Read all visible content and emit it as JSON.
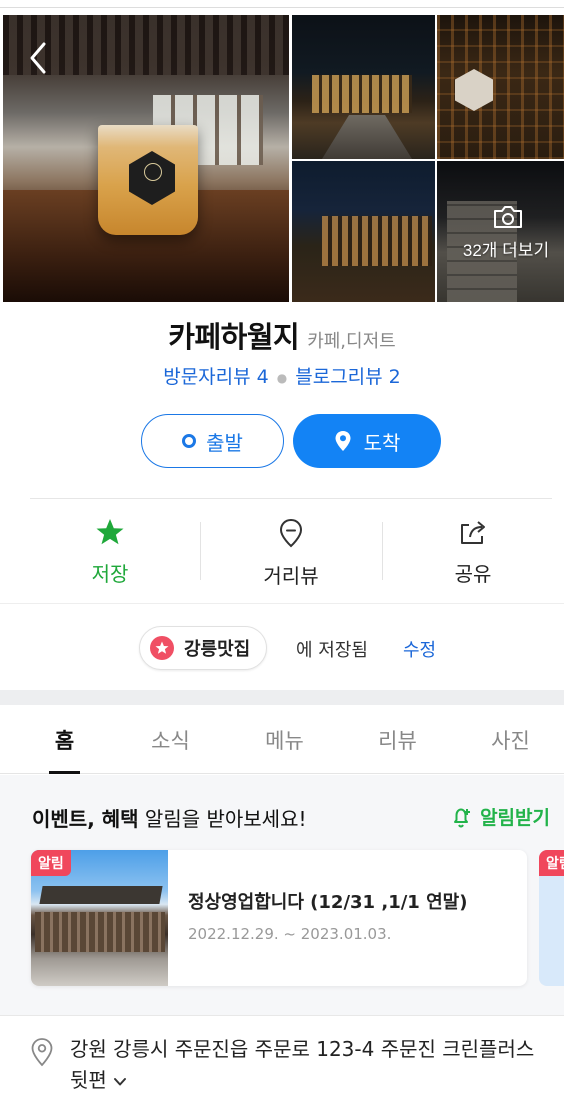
{
  "gallery": {
    "more_photos_label": "32개 더보기"
  },
  "place": {
    "name": "카페하월지",
    "category": "카페,디저트",
    "visitor_review_label": "방문자리뷰 4",
    "blog_review_label": "블로그리뷰 2"
  },
  "route": {
    "start_label": "출발",
    "arrive_label": "도착"
  },
  "actions": {
    "save_label": "저장",
    "street_view_label": "거리뷰",
    "share_label": "공유"
  },
  "saved": {
    "list_name": "강릉맛집",
    "suffix": "에 저장됨",
    "edit_label": "수정"
  },
  "tabs": [
    {
      "label": "홈",
      "active": true
    },
    {
      "label": "소식",
      "active": false
    },
    {
      "label": "메뉴",
      "active": false
    },
    {
      "label": "리뷰",
      "active": false
    },
    {
      "label": "사진",
      "active": false
    }
  ],
  "events": {
    "title_bold": "이벤트, 혜택",
    "title_rest": " 알림을 받아보세요!",
    "alarm_label": "알림받기",
    "cards": [
      {
        "badge": "알림",
        "title": "정상영업합니다 (12/31 ,1/1 연말)",
        "date": "2022.12.29. ~ 2023.01.03."
      },
      {
        "badge": "알림"
      }
    ]
  },
  "address": {
    "text": "강원 강릉시 주문진읍 주문로 123-4 주문진 크린플러스 뒷편"
  },
  "colors": {
    "accent_blue": "#1383f5",
    "link_blue": "#1b67d8",
    "save_green": "#1fa83a",
    "alarm_green": "#22b34a",
    "badge_red": "#f0475c"
  },
  "icons": {
    "back": "chevron-left-icon",
    "camera": "camera-icon",
    "save": "star-icon",
    "street_view": "map-pin-icon",
    "share": "share-icon",
    "alarm": "bell-plus-icon",
    "address": "location-pin-icon"
  }
}
